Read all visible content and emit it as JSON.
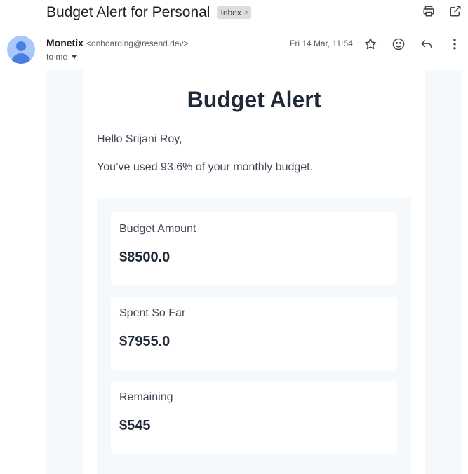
{
  "email": {
    "subject": "Budget Alert for Personal",
    "label": "Inbox",
    "label_remove": "×",
    "sender_name": "Monetix",
    "sender_email": "<onboarding@resend.dev>",
    "recipient": "to me",
    "date": "Fri 14 Mar, 11:54"
  },
  "content": {
    "headline": "Budget Alert",
    "greeting": "Hello Srijani Roy,",
    "usage_message": "You’ve used 93.6% of your monthly budget.",
    "stats": [
      {
        "label": "Budget Amount",
        "value": "$8500.0"
      },
      {
        "label": "Spent So Far",
        "value": "$7955.0"
      },
      {
        "label": "Remaining",
        "value": "$545"
      }
    ]
  },
  "icons": {
    "top": [
      "print-icon",
      "open-in-new-window-icon"
    ],
    "message": [
      "star-icon",
      "emoji-icon",
      "reply-icon",
      "more-vert-icon"
    ]
  }
}
